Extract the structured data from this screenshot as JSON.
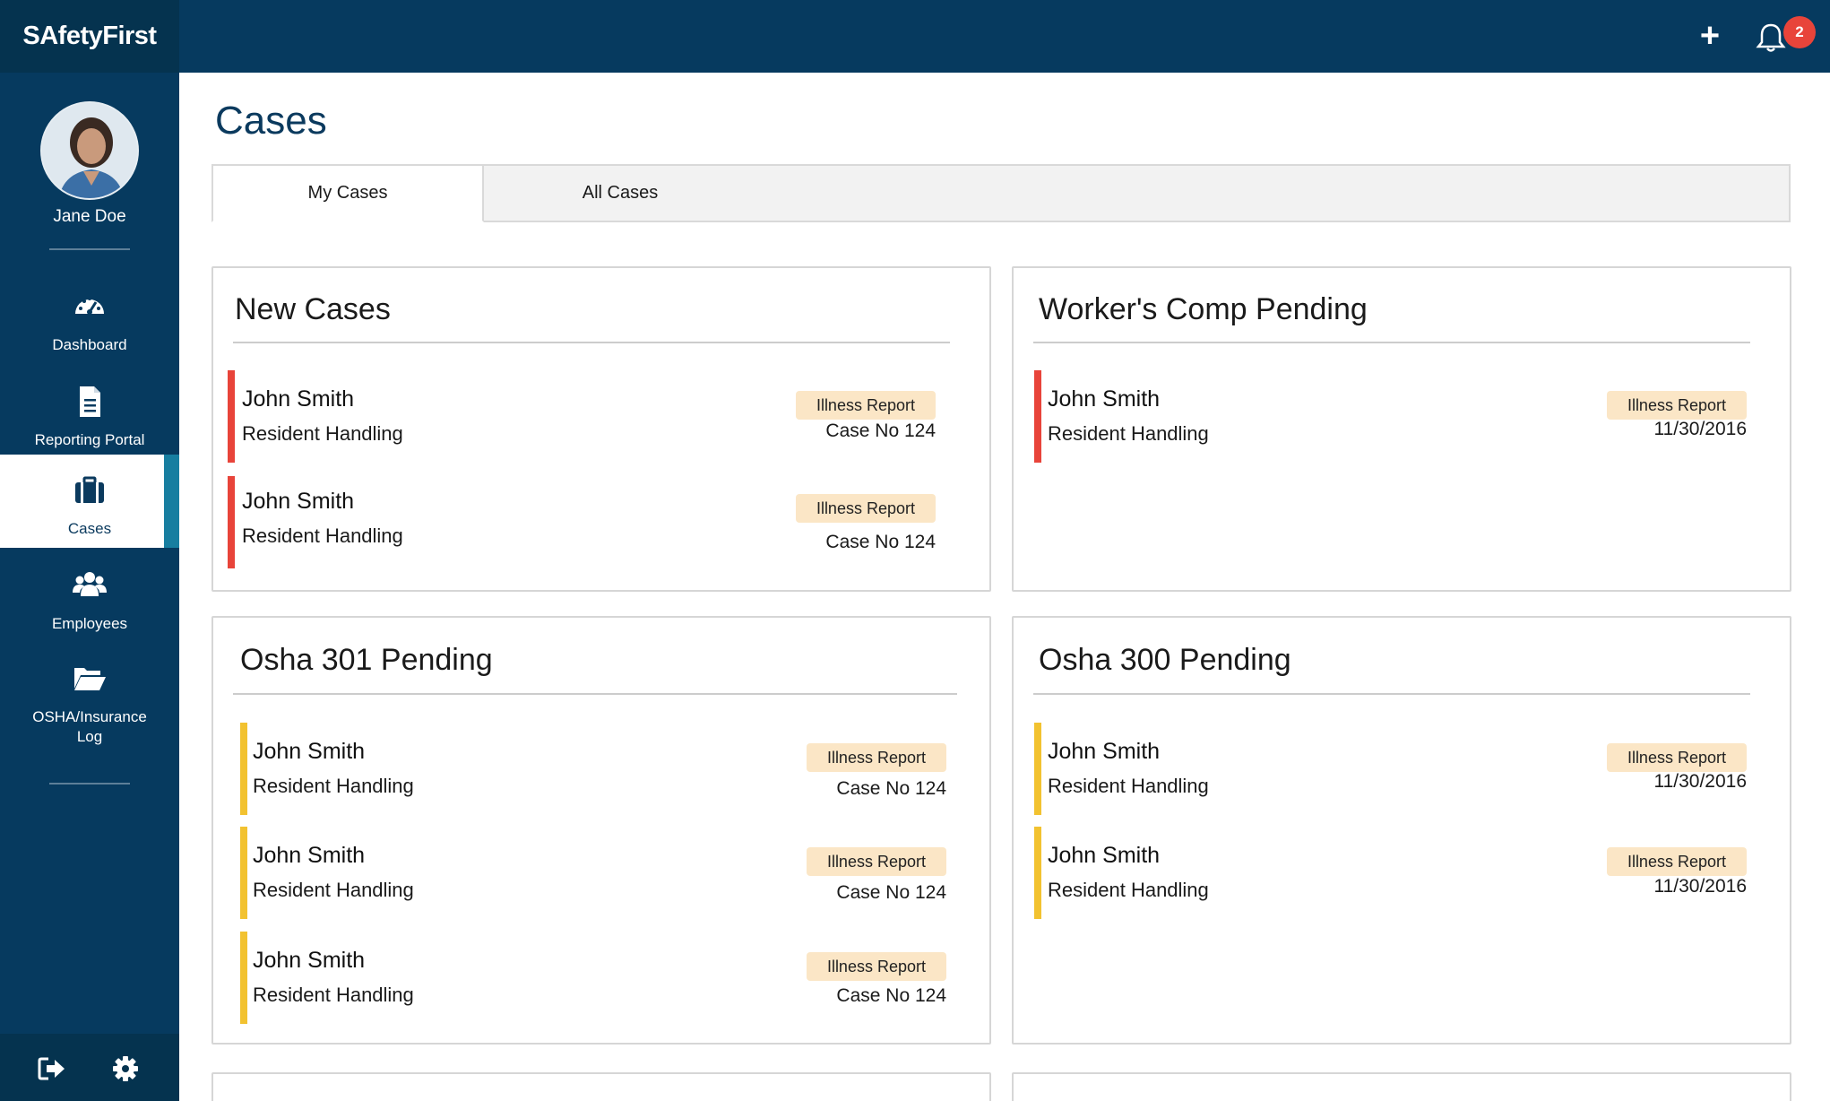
{
  "app": {
    "logo": "SAfetyFirst"
  },
  "topbar": {
    "notifications_count": "2"
  },
  "user": {
    "name": "Jane Doe"
  },
  "sidebar": {
    "items": [
      {
        "label": "Dashboard",
        "icon": "dashboard-gauge-icon"
      },
      {
        "label": "Reporting Portal",
        "icon": "document-icon"
      },
      {
        "label": "Cases",
        "icon": "briefcase-icon",
        "active": true
      },
      {
        "label": "Employees",
        "icon": "users-icon"
      },
      {
        "label": "OSHA/Insurance Log",
        "icon": "folder-open-icon"
      }
    ]
  },
  "page": {
    "title": "Cases"
  },
  "tabs": [
    {
      "label": "My Cases",
      "active": true
    },
    {
      "label": "All Cases",
      "active": false
    }
  ],
  "colors": {
    "brand": "#063a5f",
    "new": "#e8443a",
    "pending": "#f2c230",
    "badge_bg": "#fbe6c6"
  },
  "cards": [
    {
      "title": "New Cases",
      "items": [
        {
          "name": "John Smith",
          "type": "Resident Handling",
          "badge": "Illness Report",
          "meta": "Case No 124"
        },
        {
          "name": "John Smith",
          "type": "Resident Handling",
          "badge": "Illness Report",
          "meta": "Case No 124"
        }
      ]
    },
    {
      "title": "Worker's Comp Pending",
      "items": [
        {
          "name": "John Smith",
          "type": "Resident Handling",
          "badge": "Illness Report",
          "meta": "11/30/2016"
        }
      ]
    },
    {
      "title": "Osha 301 Pending",
      "items": [
        {
          "name": "John Smith",
          "type": "Resident Handling",
          "badge": "Illness Report",
          "meta": "Case No 124"
        },
        {
          "name": "John Smith",
          "type": "Resident Handling",
          "badge": "Illness Report",
          "meta": "Case No 124"
        },
        {
          "name": "John Smith",
          "type": "Resident Handling",
          "badge": "Illness Report",
          "meta": "Case No 124"
        }
      ]
    },
    {
      "title": "Osha 300 Pending",
      "items": [
        {
          "name": "John Smith",
          "type": "Resident Handling",
          "badge": "Illness Report",
          "meta": "11/30/2016"
        },
        {
          "name": "John Smith",
          "type": "Resident Handling",
          "badge": "Illness Report",
          "meta": "11/30/2016"
        }
      ]
    }
  ]
}
